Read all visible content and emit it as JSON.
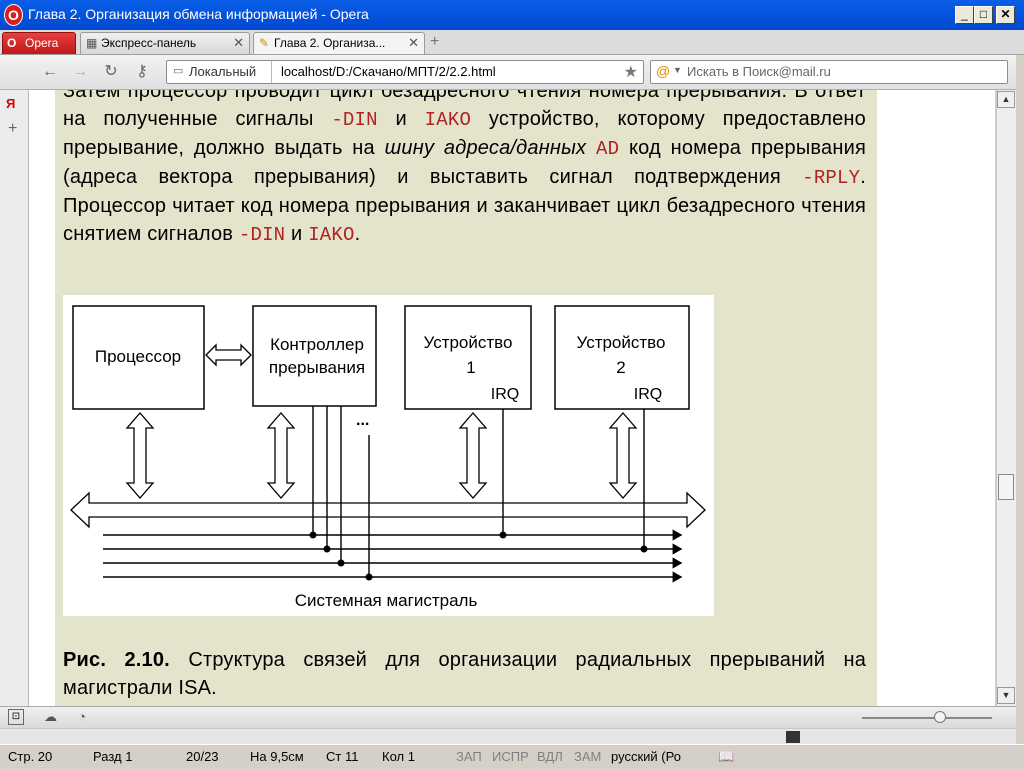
{
  "window": {
    "title": "Глава 2. Организация обмена информацией - Opera"
  },
  "tabs": {
    "menu_label": "Opera",
    "items": [
      {
        "label": "Экспресс-панель"
      },
      {
        "label": "Глава 2. Организа..."
      }
    ]
  },
  "address": {
    "security_label": "Локальный",
    "url": "localhost/D:/Скачано/МПТ/2/2.2.html",
    "search_placeholder": "Искать в Поиск@mail.ru"
  },
  "content": {
    "p1": [
      {
        "t": "Затем процессор проводит цикл безадресного чтения номера прерывания. В ответ на полученные сигналы "
      },
      {
        "m": "-DIN"
      },
      {
        "t": " и "
      },
      {
        "m": "IAKO"
      },
      {
        "t": " устройство, которому предоставлено прерывание, должно выдать на "
      },
      {
        "i": "шину адреса/данных"
      },
      {
        "t": " "
      },
      {
        "m": "AD"
      },
      {
        "t": " код номера прерывания (адреса вектора прерывания) и выставить сигнал подтверждения "
      },
      {
        "m": "-RPLY"
      },
      {
        "t": ". Процессор читает код номера прерывания и заканчивает цикл безадресного чтения снятием сигналов "
      },
      {
        "m": "-DIN"
      },
      {
        "t": " и "
      },
      {
        "m": "IAKO"
      },
      {
        "t": "."
      }
    ],
    "figure": {
      "processor": "Процессор",
      "controller_line1": "Контроллер",
      "controller_line2": "прерывания",
      "dev1_line1": "Устройство",
      "dev1_line2": "1",
      "dev2_line1": "Устройство",
      "dev2_line2": "2",
      "irq": "IRQ",
      "ellipsis": "...",
      "bus_label": "Системная магистраль"
    },
    "caption_bold": "Рис. 2.10.",
    "caption_text": "Структура связей для организации радиальных прерываний на магистрали ISA."
  },
  "status": {
    "page": "Стр. 20",
    "section": "Разд 1",
    "pages": "20/23",
    "at": "На 9,5см",
    "line": "Ст 11",
    "col": "Кол 1",
    "rec": "ЗАП",
    "trk": "ИСПР",
    "ext": "ВДЛ",
    "ovr": "ЗАМ",
    "lang": "русский (Ро"
  }
}
